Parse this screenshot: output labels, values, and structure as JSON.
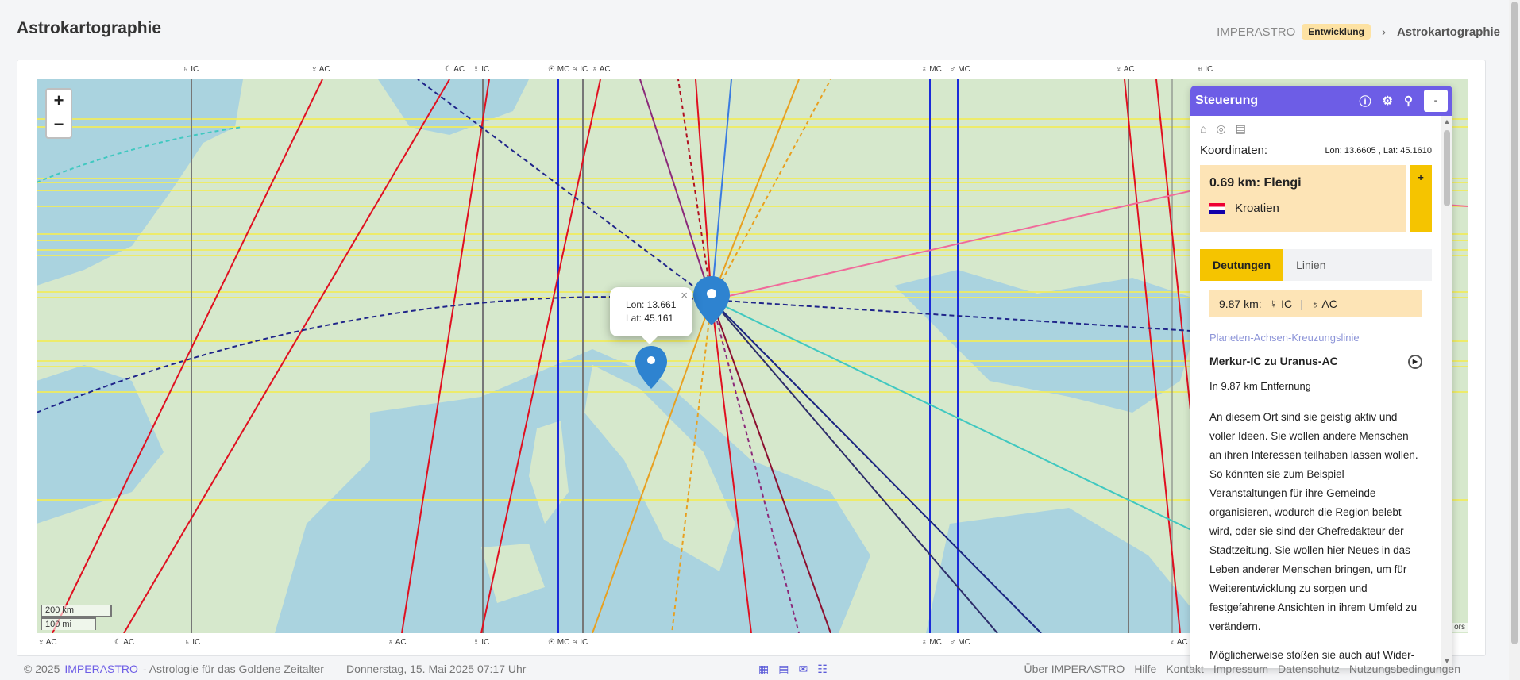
{
  "page": {
    "title": "Astrokartographie"
  },
  "breadcrumb": {
    "brand": "IMPERASTRO",
    "badge": "Entwicklung",
    "separator": "›",
    "current": "Astrokartographie"
  },
  "map": {
    "zoom_in": "+",
    "zoom_out": "−",
    "scale_km": "200 km",
    "scale_mi": "100 mi",
    "attribution": "ors",
    "popup": {
      "close": "×",
      "lon": "Lon: 13.661",
      "lat": "Lat: 45.161"
    },
    "top_axis_labels": [
      "♄ IC",
      "♆ AC",
      "☾ AC",
      "☿ IC",
      "☉ MC",
      "♃ IC",
      "♁ AC",
      "♁ MC",
      "♂ MC",
      "♀ AC",
      "♅ IC"
    ],
    "bottom_axis_labels": [
      "♆ AC",
      "☾ AC",
      "♄ IC",
      "♁ AC",
      "☿ IC",
      "☉ MC",
      "♃ IC",
      "♁ MC",
      "♂ MC",
      "♀ AC"
    ]
  },
  "panel": {
    "title": "Steuerung",
    "minimize": "-",
    "coordinates_label": "Koordinaten:",
    "coordinates_value": "Lon: 13.6605 , Lat: 45.1610",
    "location": {
      "distance": "0.69 km: Flengi",
      "country": "Kroatien",
      "add": "+"
    },
    "tabs": [
      "Deutungen",
      "Linien"
    ],
    "entry": {
      "km": "9.87 km:",
      "planet_a": "☿  IC",
      "planet_b": "♁  AC",
      "category": "Planeten-Achsen-Kreuzungslinie",
      "title": "Merkur-IC zu Uranus-AC",
      "distance": "In 9.87 km Entfernung",
      "text": "An diesem Ort sind sie geistig aktiv und voller Ideen. Sie wollen andere Menschen an ihren Interessen teilhaben lassen wollen. So könnten sie zum Beispiel Veranstaltungen für ihre Gemeinde organisieren, wodurch die Region belebt wird, oder sie sind der Chefredakteur der Stadtzeitung. Sie wollen hier Neues in das Leben anderer Menschen bringen, um für Weiterentwicklung zu sorgen und festgefahrene Ansichten in ihrem Umfeld zu verändern.",
      "text2": "Möglicherweise stoßen sie auch auf Wider-spruch, doch macht dies in gewisser"
    }
  },
  "footer": {
    "copyright": "© 2025",
    "brand": "IMPERASTRO",
    "tagline": "- Astrologie für das Goldene Zeitalter",
    "date": "Donnerstag,  15. Mai 2025 07:17 Uhr",
    "links": [
      "Über IMPERASTRO",
      "Hilfe",
      "Kontakt",
      "Impressum",
      "Datenschutz",
      "Nutzungsbedingungen"
    ]
  },
  "colors": {
    "accent": "#6d5de6",
    "yellow": "#f5c400",
    "peach": "#fde4b6"
  }
}
